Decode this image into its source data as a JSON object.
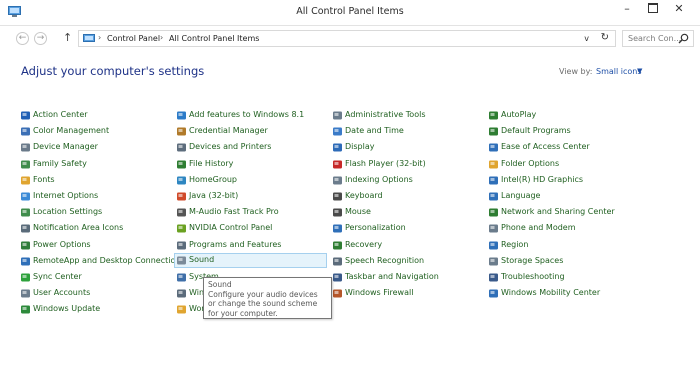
{
  "window": {
    "title": "All Control Panel Items",
    "minimize": "–",
    "close": "✕"
  },
  "nav": {
    "back": "←",
    "forward": "→",
    "up": "↑",
    "breadcrumbs": [
      "Control Panel",
      "All Control Panel Items"
    ],
    "separator": "›",
    "dropdown": "v",
    "refresh": "↻",
    "search_placeholder": "Search Con..."
  },
  "header": {
    "heading": "Adjust your computer's settings",
    "view_by_label": "View by:",
    "view_by_value": "Small icons",
    "view_by_arrow": "▼"
  },
  "columns": [
    [
      {
        "label": "Action Center",
        "icon": "flag-icon",
        "color": "#1f5fb5"
      },
      {
        "label": "Color Management",
        "icon": "monitor-icon",
        "color": "#3b6fb5"
      },
      {
        "label": "Device Manager",
        "icon": "device-manager-icon",
        "color": "#6a7a8a"
      },
      {
        "label": "Family Safety",
        "icon": "family-icon",
        "color": "#3f8c4b"
      },
      {
        "label": "Fonts",
        "icon": "fonts-icon",
        "color": "#e0a530"
      },
      {
        "label": "Internet Options",
        "icon": "globe-icon",
        "color": "#3a8ad6"
      },
      {
        "label": "Location Settings",
        "icon": "location-icon",
        "color": "#3f8c4b"
      },
      {
        "label": "Notification Area Icons",
        "icon": "notification-icon",
        "color": "#5a6b7a"
      },
      {
        "label": "Power Options",
        "icon": "power-icon",
        "color": "#2f7d3a"
      },
      {
        "label": "RemoteApp and Desktop Connections",
        "icon": "remoteapp-icon",
        "color": "#2f6fb8"
      },
      {
        "label": "Sync Center",
        "icon": "sync-icon",
        "color": "#2da13b"
      },
      {
        "label": "User Accounts",
        "icon": "users-icon",
        "color": "#6b7c8c"
      },
      {
        "label": "Windows Update",
        "icon": "windows-update-icon",
        "color": "#2d8a3b"
      }
    ],
    [
      {
        "label": "Add features to Windows 8.1",
        "icon": "add-features-icon",
        "color": "#2c7bc8"
      },
      {
        "label": "Credential Manager",
        "icon": "credential-icon",
        "color": "#b07a2a"
      },
      {
        "label": "Devices and Printers",
        "icon": "printer-icon",
        "color": "#5d6d7d"
      },
      {
        "label": "File History",
        "icon": "file-history-icon",
        "color": "#2e7d32"
      },
      {
        "label": "HomeGroup",
        "icon": "homegroup-icon",
        "color": "#2e86c1"
      },
      {
        "label": "Java (32-bit)",
        "icon": "java-icon",
        "color": "#d04a2a"
      },
      {
        "label": "M-Audio Fast Track Pro",
        "icon": "audio-device-icon",
        "color": "#555555"
      },
      {
        "label": "NVIDIA Control Panel",
        "icon": "nvidia-icon",
        "color": "#6aa121"
      },
      {
        "label": "Programs and Features",
        "icon": "programs-icon",
        "color": "#5b6b7b"
      },
      {
        "label": "Sound",
        "icon": "speaker-icon",
        "color": "#7b8a99"
      },
      {
        "label": "System",
        "icon": "system-icon",
        "color": "#3f6fa8"
      },
      {
        "label": "Windows Defender",
        "icon": "defender-icon",
        "color": "#5b6b7b"
      },
      {
        "label": "Work Folders",
        "icon": "work-folders-icon",
        "color": "#e0a530"
      }
    ],
    [
      {
        "label": "Administrative Tools",
        "icon": "admin-tools-icon",
        "color": "#6b7c8c"
      },
      {
        "label": "Date and Time",
        "icon": "clock-icon",
        "color": "#3a7bc8"
      },
      {
        "label": "Display",
        "icon": "display-icon",
        "color": "#2d6bb8"
      },
      {
        "label": "Flash Player (32-bit)",
        "icon": "flash-icon",
        "color": "#c62828"
      },
      {
        "label": "Indexing Options",
        "icon": "indexing-icon",
        "color": "#6b7c8c"
      },
      {
        "label": "Keyboard",
        "icon": "keyboard-icon",
        "color": "#4a4a4a"
      },
      {
        "label": "Mouse",
        "icon": "mouse-icon",
        "color": "#4a4a4a"
      },
      {
        "label": "Personalization",
        "icon": "personalization-icon",
        "color": "#2f6fb8"
      },
      {
        "label": "Recovery",
        "icon": "recovery-icon",
        "color": "#2e7d32"
      },
      {
        "label": "Speech Recognition",
        "icon": "microphone-icon",
        "color": "#5b6b7b"
      },
      {
        "label": "Taskbar and Navigation",
        "icon": "taskbar-icon",
        "color": "#3a5a8a"
      },
      {
        "label": "Windows Firewall",
        "icon": "firewall-icon",
        "color": "#b5562a"
      }
    ],
    [
      {
        "label": "AutoPlay",
        "icon": "autoplay-icon",
        "color": "#2e7d32"
      },
      {
        "label": "Default Programs",
        "icon": "default-programs-icon",
        "color": "#2e7d32"
      },
      {
        "label": "Ease of Access Center",
        "icon": "ease-of-access-icon",
        "color": "#2f6fb8"
      },
      {
        "label": "Folder Options",
        "icon": "folder-icon",
        "color": "#e0a530"
      },
      {
        "label": "Intel(R) HD Graphics",
        "icon": "intel-graphics-icon",
        "color": "#2f6fb8"
      },
      {
        "label": "Language",
        "icon": "language-icon",
        "color": "#2f6fb8"
      },
      {
        "label": "Network and Sharing Center",
        "icon": "network-icon",
        "color": "#2e7d32"
      },
      {
        "label": "Phone and Modem",
        "icon": "phone-icon",
        "color": "#6b7c8c"
      },
      {
        "label": "Region",
        "icon": "region-icon",
        "color": "#2f6fb8"
      },
      {
        "label": "Storage Spaces",
        "icon": "storage-icon",
        "color": "#6b7c8c"
      },
      {
        "label": "Troubleshooting",
        "icon": "troubleshooting-icon",
        "color": "#3a5a8a"
      },
      {
        "label": "Windows Mobility Center",
        "icon": "mobility-icon",
        "color": "#2f6fb8"
      }
    ]
  ],
  "hover_item": "Sound",
  "tooltip": {
    "title": "Sound",
    "text": "Configure your audio devices or change the sound scheme for your computer."
  },
  "colors": {
    "link": "#1f5f1f",
    "heading": "#1e3287",
    "hover_bg": "#e5f3fb",
    "hover_border": "#a5d0ee"
  }
}
